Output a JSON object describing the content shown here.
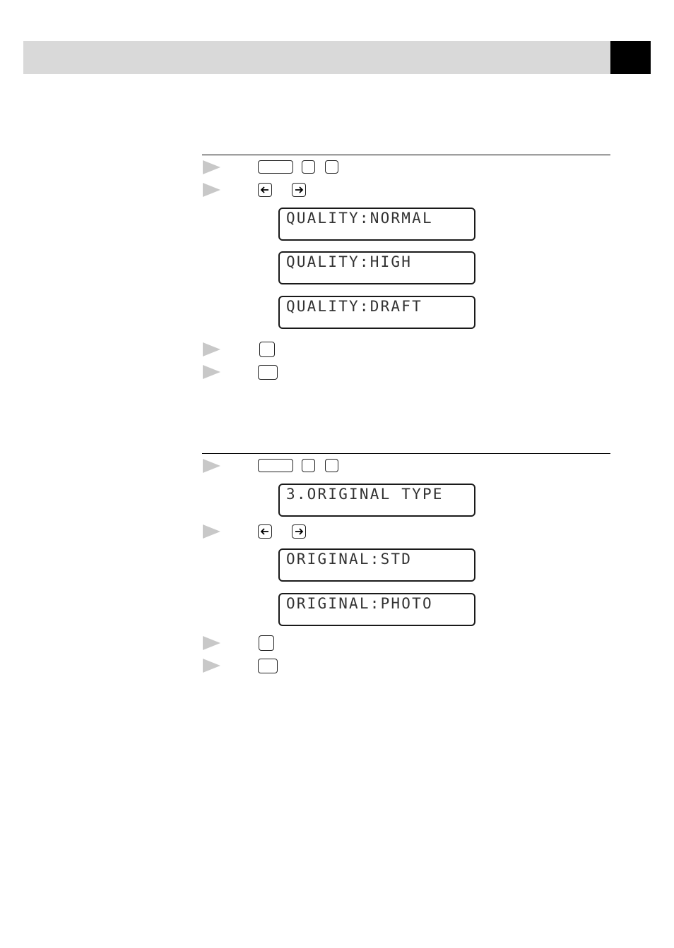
{
  "header": {
    "accent_color": "#d9d9d9",
    "tab_color": "#000000"
  },
  "section_quality": {
    "steps": [
      {
        "icon": "step-bullet-icon",
        "keys": [
          "menu-key",
          "number-key",
          "number-key"
        ]
      },
      {
        "icon": "step-bullet-icon",
        "keys": [
          "left-arrow-key",
          "right-arrow-key"
        ]
      },
      {
        "icon": "step-bullet-icon",
        "keys": [
          "set-key"
        ]
      },
      {
        "icon": "step-bullet-icon",
        "keys": [
          "stop-key"
        ]
      }
    ],
    "lcd_options": [
      "QUALITY:NORMAL",
      "QUALITY:HIGH",
      "QUALITY:DRAFT"
    ]
  },
  "section_original": {
    "steps": [
      {
        "icon": "step-bullet-icon",
        "keys": [
          "menu-key",
          "number-key",
          "number-key"
        ]
      },
      {
        "icon": "step-bullet-icon",
        "keys": [
          "left-arrow-key",
          "right-arrow-key"
        ]
      },
      {
        "icon": "step-bullet-icon",
        "keys": [
          "set-key"
        ]
      },
      {
        "icon": "step-bullet-icon",
        "keys": [
          "stop-key"
        ]
      }
    ],
    "lcd_menu": "3.ORIGINAL TYPE",
    "lcd_options": [
      "ORIGINAL:STD",
      "ORIGINAL:PHOTO"
    ]
  },
  "colors": {
    "bullet": "#c8c8c8",
    "lcd_text": "#333333"
  }
}
